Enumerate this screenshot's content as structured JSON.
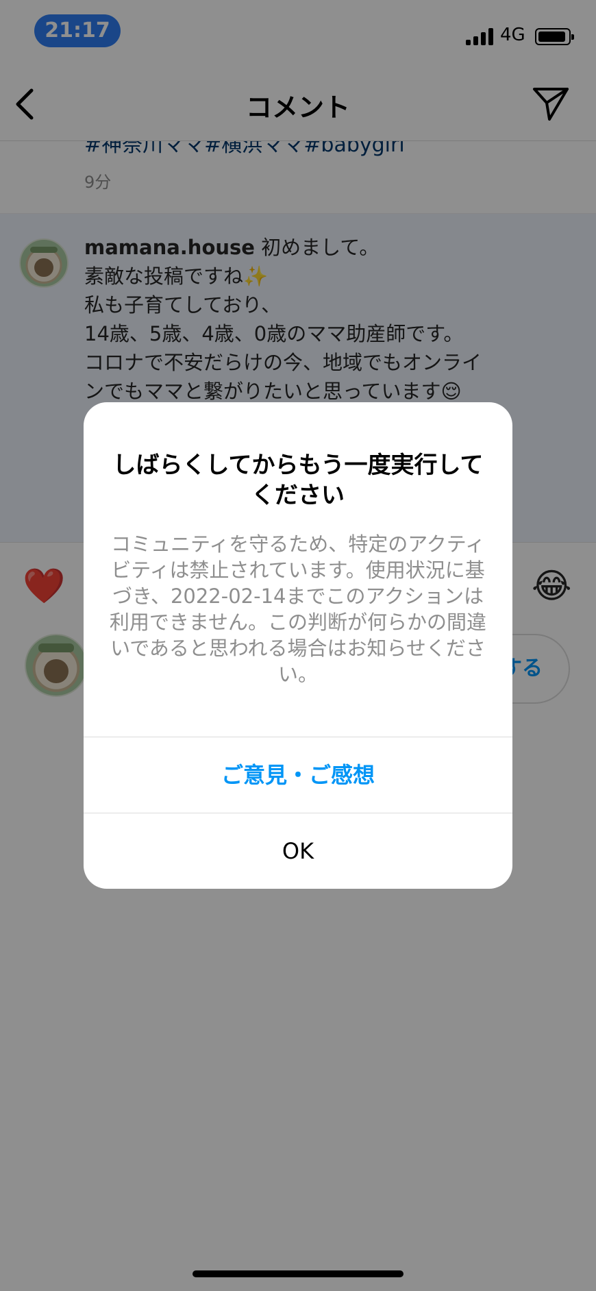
{
  "status_bar": {
    "time": "21:17",
    "network": "4G",
    "battery_level": 0.85
  },
  "nav": {
    "title": "コメント",
    "back_icon": "chevron-left-icon",
    "send_icon": "paper-plane-icon"
  },
  "caption": {
    "tags": "#神奈川ママ#横浜ママ#babygirl",
    "time": "9分"
  },
  "comment": {
    "username": "mamana.house",
    "lines": [
      "初めまして。",
      "素敵な投稿ですね✨",
      "私も子育てしており、",
      "14歳、5歳、4歳、0歳のママ助産師です。",
      "コロナで不安だらけの今、地域でもオンライ",
      "ンでもママと繋がりたいと思っています😌"
    ]
  },
  "reactions": {
    "first": "❤️",
    "last": "😂"
  },
  "compose": {
    "post_label": "する"
  },
  "dialog": {
    "title": "しばらくしてからもう一度実行してください",
    "message": "コミュニティを守るため、特定のアクティビティは禁止されています。使用状況に基づき、2022-02-14までこのアクションは利用できません。この判断が何らかの間違いであると思われる場合はお知らせください。",
    "feedback_label": "ご意見・ご感想",
    "ok_label": "OK"
  },
  "colors": {
    "accent": "#0095f6",
    "time_pill": "#2f7ef2",
    "overlay": "rgba(0,0,0,0.44)"
  }
}
